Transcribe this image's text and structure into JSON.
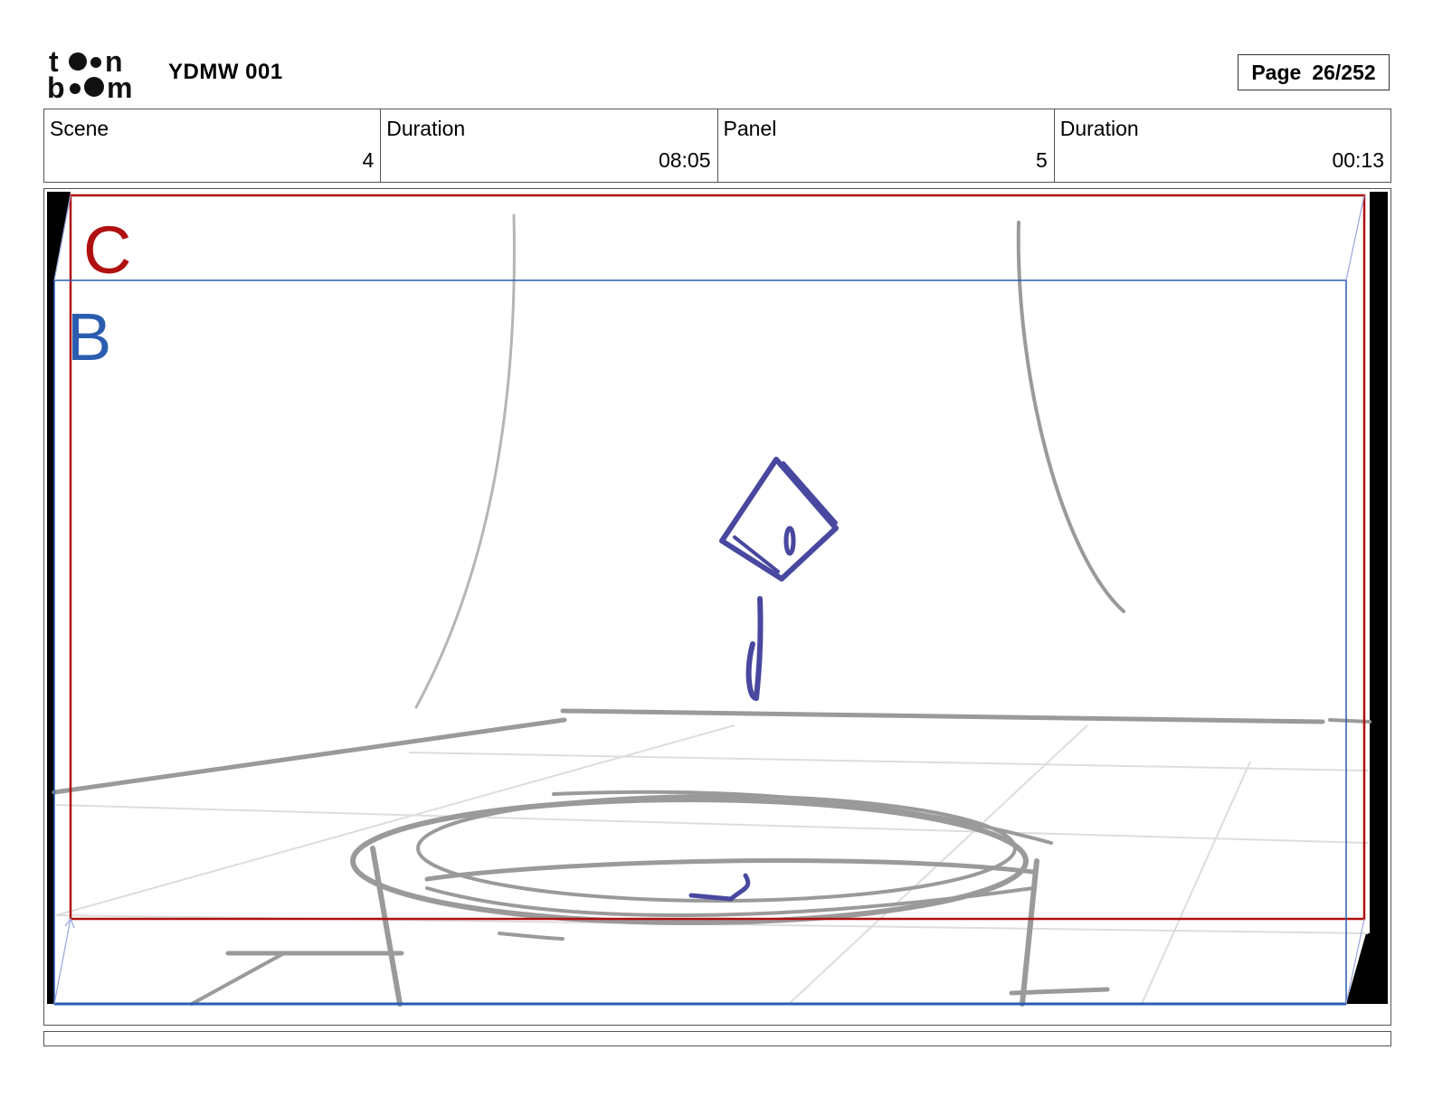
{
  "header": {
    "logo_text_top": "toon",
    "logo_text_bottom": "boom",
    "project_title": "YDMW 001",
    "page_label": "Page",
    "page_number": "26/252"
  },
  "info": {
    "scene_label": "Scene",
    "scene_value": "4",
    "scene_duration_label": "Duration",
    "scene_duration_value": "08:05",
    "panel_label": "Panel",
    "panel_value": "5",
    "panel_duration_label": "Duration",
    "panel_duration_value": "00:13"
  },
  "panel": {
    "camera_c_label": "C",
    "camera_b_label": "B",
    "colors": {
      "camera_c": "#b01010",
      "camera_b": "#2a5db0",
      "sketch_gray": "#9a9a9a",
      "sketch_blue": "#4848a0"
    }
  },
  "caption": {
    "text": ""
  }
}
